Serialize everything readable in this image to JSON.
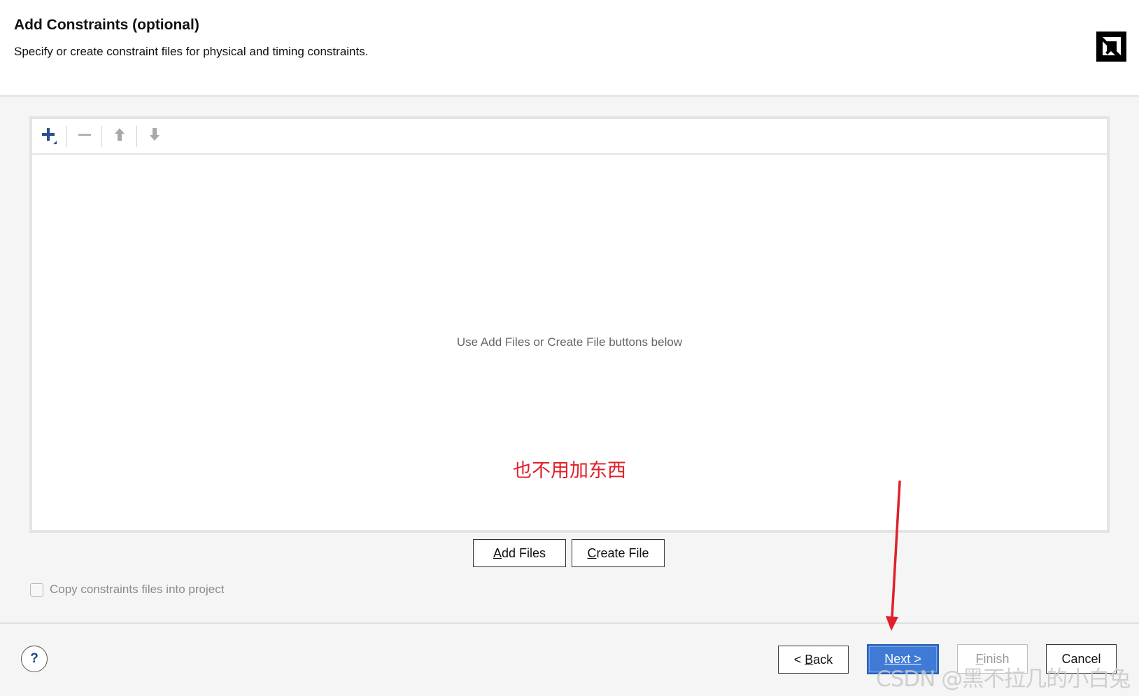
{
  "header": {
    "title": "Add Constraints (optional)",
    "subtitle": "Specify or create constraint files for physical and timing constraints."
  },
  "toolbar": {
    "icons": [
      "plus-icon",
      "minus-icon",
      "arrow-up-icon",
      "arrow-down-icon"
    ]
  },
  "file_list": {
    "empty_message": "Use Add Files or Create File buttons below"
  },
  "annotation": {
    "text": "也不用加东西",
    "color": "#e0202a"
  },
  "actions": {
    "add_files_prefix": "A",
    "add_files_rest": "dd Files",
    "create_file_prefix": "C",
    "create_file_rest": "reate File"
  },
  "options": {
    "copy_label": "Copy constraints files into project",
    "copy_checked": false
  },
  "footer": {
    "help_label": "?",
    "back_pre": "< ",
    "back_ul": "B",
    "back_rest": "ack",
    "next_ul": "N",
    "next_rest": "ext >",
    "finish_ul": "F",
    "finish_rest": "inish",
    "cancel_label": "Cancel"
  },
  "watermark": "CSDN @黑不拉几的小白兔",
  "colors": {
    "accent": "#3f7bd6",
    "annotation_red": "#e0202a"
  }
}
